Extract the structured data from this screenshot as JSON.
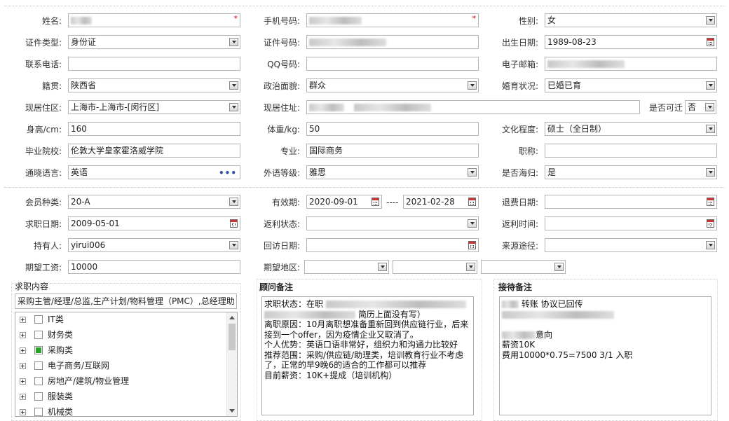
{
  "personal": {
    "name": {
      "label": "姓名:",
      "value": ""
    },
    "mobile": {
      "label": "手机号码:",
      "value": ""
    },
    "gender": {
      "label": "性别:",
      "value": "女"
    },
    "id_type": {
      "label": "证件类型:",
      "value": "身份证"
    },
    "id_no": {
      "label": "证件号码:",
      "value": ""
    },
    "birth": {
      "label": "出生日期:",
      "value": "1989-08-23"
    },
    "phone": {
      "label": "联系电话:",
      "value": ""
    },
    "qq": {
      "label": "QQ号码:",
      "value": ""
    },
    "email": {
      "label": "电子邮箱:",
      "value": ""
    },
    "native": {
      "label": "籍贯:",
      "value": "陕西省"
    },
    "political": {
      "label": "政治面貌:",
      "value": "群众"
    },
    "marital": {
      "label": "婚育状况:",
      "value": "已婚已育"
    },
    "residence_area": {
      "label": "现居住区:",
      "value": "上海市-上海市-[闵行区]"
    },
    "address": {
      "label": "现居住址:",
      "value": ""
    },
    "relocate": {
      "label": "是否可迁",
      "value": "否"
    },
    "height": {
      "label": "身高/cm:",
      "value": "160"
    },
    "weight": {
      "label": "体重/kg:",
      "value": "50"
    },
    "education": {
      "label": "文化程度:",
      "value": "硕士（全日制）"
    },
    "school": {
      "label": "毕业院校:",
      "value": "伦敦大学皇家霍洛威学院"
    },
    "major": {
      "label": "专业:",
      "value": "国际商务"
    },
    "title": {
      "label": "职称:",
      "value": ""
    },
    "language": {
      "label": "通晓语言:",
      "value": "英语"
    },
    "lang_level": {
      "label": "外语等级:",
      "value": "雅思"
    },
    "overseas": {
      "label": "是否海归:",
      "value": "是"
    }
  },
  "member": {
    "type": {
      "label": "会员种类:",
      "value": "20-A"
    },
    "valid": {
      "label": "有效期:",
      "from": "2020-09-01",
      "sep": "----",
      "to": "2021-02-28"
    },
    "refund_date": {
      "label": "退费日期:",
      "value": ""
    },
    "apply_date": {
      "label": "求职日期:",
      "value": "2009-05-01"
    },
    "rebate_status": {
      "label": "返利状态:",
      "value": ""
    },
    "rebate_time": {
      "label": "返利时间:",
      "value": ""
    },
    "holder": {
      "label": "持有人:",
      "value": "yirui006"
    },
    "visit_date": {
      "label": "回访日期:",
      "value": ""
    },
    "source": {
      "label": "来源途径:",
      "value": ""
    },
    "salary": {
      "label": "期望工资:",
      "value": "10000"
    },
    "region": {
      "label": "期望地区:",
      "values": [
        "",
        "",
        ""
      ]
    }
  },
  "job": {
    "title": "求职内容",
    "summary": "采购主管/经理/总监,生产计划/物料管理（PMC）,总经理助",
    "tree": [
      {
        "label": "IT类",
        "checked": false
      },
      {
        "label": "财务类",
        "checked": false
      },
      {
        "label": "采购类",
        "checked": true
      },
      {
        "label": "电子商务/互联网",
        "checked": false
      },
      {
        "label": "房地产/建筑/物业管理",
        "checked": false
      },
      {
        "label": "服装类",
        "checked": false
      },
      {
        "label": "机械类",
        "checked": false
      }
    ]
  },
  "advisor": {
    "title": "顾问备注",
    "lines": {
      "l1": "求职状态：在职",
      "l2": "简历上面没有写）",
      "l3": "离职原因：10月离职想准备重新回到供应链行业，后来",
      "l4": "接到一个offer，因为疫情企业又取消了。",
      "l5": "个人优势：英语口语非常好，组织力和沟通力比较好",
      "l6": "推荐范围：采购/供应链/助理类，培训教育行业不考虑",
      "l7": "了，正常的早9晚6的适合的工作都可以推荐",
      "l8": "目前薪资：10K+提成（培训机构）"
    }
  },
  "reception": {
    "title": "接待备注",
    "lines": {
      "l1": "转账 协议已回传",
      "l2": "意向",
      "l3": "薪资10K",
      "l4": "费用10000*0.75=7500 3/1 入职"
    }
  }
}
